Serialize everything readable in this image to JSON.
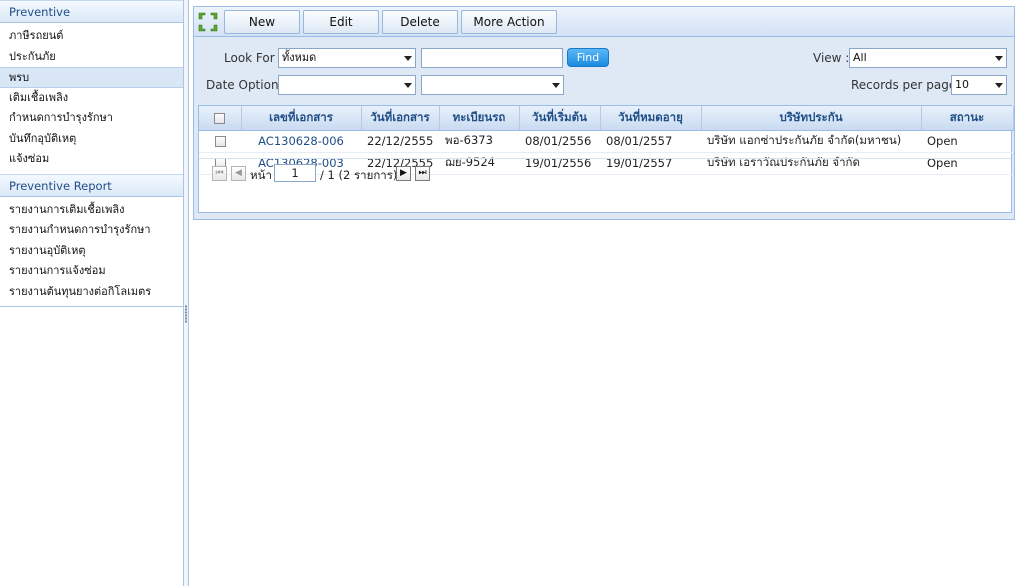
{
  "sidebar": {
    "sections": [
      {
        "title": "Preventive",
        "items": [
          "ภาษีรถยนต์",
          "ประกันภัย",
          "พรบ",
          "เติมเชื้อเพลิง",
          "กำหนดการบำรุงรักษา",
          "บันทึกอุบัติเหตุ",
          "แจ้งซ่อม"
        ],
        "active_index": 2
      },
      {
        "title": "Preventive Report",
        "items": [
          "รายงานการเติมเชื้อเพลิง",
          "รายงานกำหนดการบำรุงรักษา",
          "รายงานอุบัติเหตุ",
          "รายงานการแจ้งซ่อม",
          "รายงานต้นทุนยางต่อกิโลเมตร"
        ]
      }
    ]
  },
  "toolbar": {
    "new_label": "New",
    "edit_label": "Edit",
    "delete_label": "Delete",
    "more_label": "More Action",
    "icon": "grid-arrows-icon"
  },
  "filters": {
    "look_for_label": "Look For :",
    "look_for_value": "ทั้งหมด",
    "search_value": "",
    "find_label": "Find",
    "date_option_label": "Date Option :",
    "date_option_value": "",
    "date_option_2_value": "",
    "view_label": "View :",
    "view_value": "All",
    "records_label": "Records per page :",
    "records_value": "10"
  },
  "table": {
    "columns": [
      "เลขที่เอกสาร",
      "วันที่เอกสาร",
      "ทะเบียนรถ",
      "วันที่เริ่มต้น",
      "วันที่หมดอายุ",
      "บริษัทประกัน",
      "สถานะ"
    ],
    "rows": [
      [
        "AC130628-006",
        "22/12/2555",
        "พอ-6373",
        "08/01/2556",
        "08/01/2557",
        "บริษัท แอกซ่าประกันภัย จำกัด(มหาชน)",
        "Open"
      ],
      [
        "AC130628-003",
        "22/12/2555",
        "ฌย-9524",
        "19/01/2556",
        "19/01/2557",
        "บริษัท เอราวัณประกันภัย จำกัด",
        "Open"
      ]
    ]
  },
  "pager": {
    "page_label": "หน้า",
    "page_value": "1",
    "of_text": "/ 1 (2 รายการ)"
  },
  "colors": {
    "accent": "#1f4e86",
    "find_button": "#1a8ae0",
    "panel_bg": "#dfe9f6",
    "border": "#99bce8"
  }
}
